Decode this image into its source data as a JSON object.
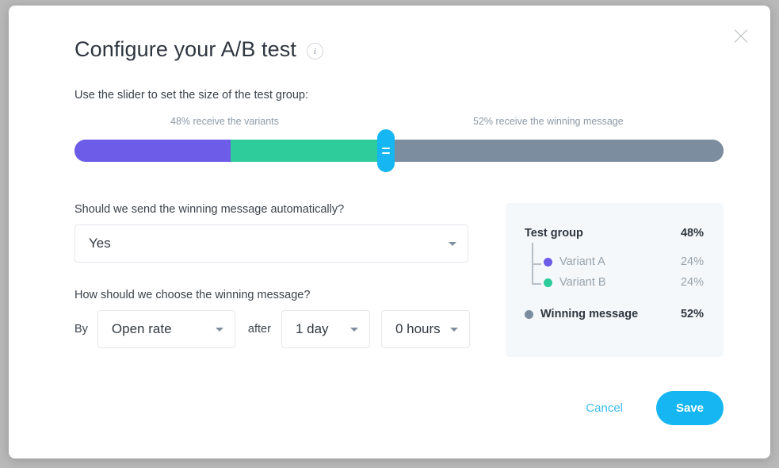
{
  "modal": {
    "title": "Configure your A/B test",
    "info_icon_label": "i",
    "close_icon_label": "close-icon"
  },
  "slider": {
    "prompt": "Use the slider to set the size of the test group:",
    "left_label": "48% receive the variants",
    "right_label": "52% receive the winning message",
    "test_group_percent": 48,
    "winning_percent": 52,
    "variant_a_percent": 24,
    "variant_b_percent": 24,
    "colors": {
      "variant_a": "#6c5ce7",
      "variant_b": "#2ecc9b",
      "winning": "#7b8d9e",
      "handle": "#16b6f2"
    }
  },
  "form": {
    "auto_send_question": "Should we send the winning message automatically?",
    "auto_send_value": "Yes",
    "choose_question": "How should we choose the winning message?",
    "by_text": "By",
    "metric_value": "Open rate",
    "after_text": "after",
    "days_value": "1 day",
    "hours_value": "0 hours"
  },
  "summary": {
    "rows": [
      {
        "label": "Test group",
        "percent": "48%"
      },
      {
        "label": "Variant A",
        "percent": "24%"
      },
      {
        "label": "Variant B",
        "percent": "24%"
      },
      {
        "label": "Winning message",
        "percent": "52%"
      }
    ]
  },
  "footer": {
    "cancel_label": "Cancel",
    "save_label": "Save"
  }
}
